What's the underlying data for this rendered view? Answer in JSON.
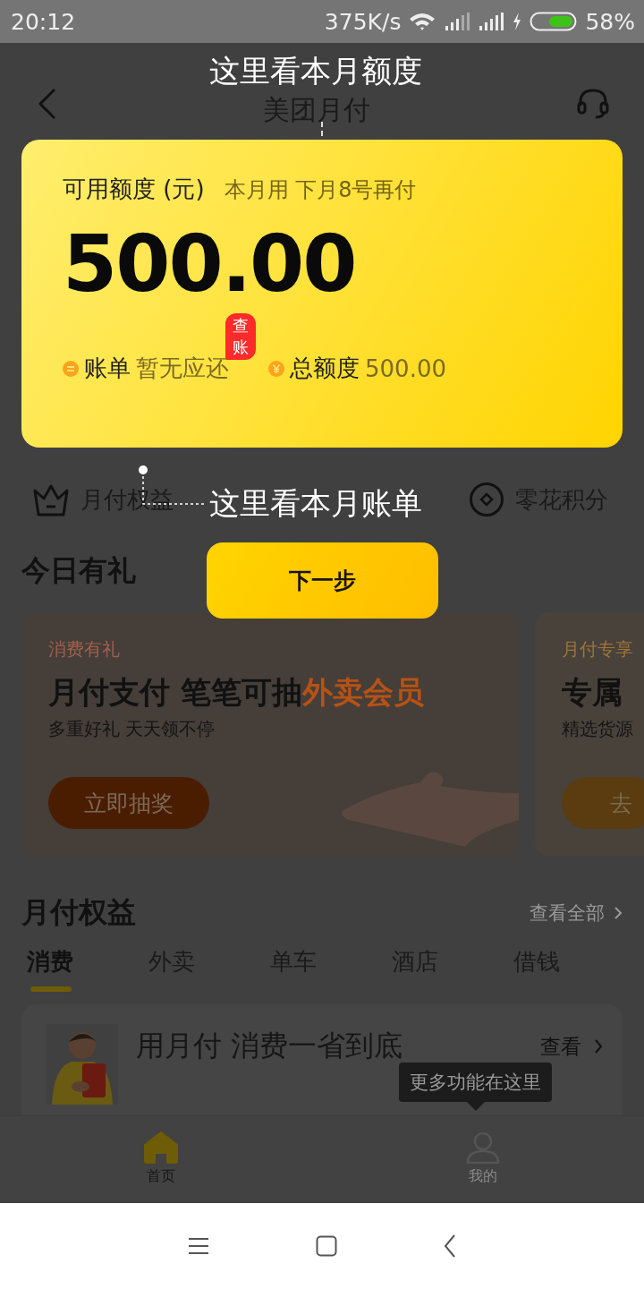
{
  "status_bar": {
    "time": "20:12",
    "speed": "375K/s",
    "battery": "58%"
  },
  "header": {
    "title": "美团月付"
  },
  "credit_card": {
    "label": "可用额度 (元)",
    "note": "本月用 下月8号再付",
    "amount": "500.00",
    "bill_badge": "查账",
    "bill_label": "账单",
    "bill_status": "暂无应还",
    "total_label": "总额度",
    "total_value": "500.00"
  },
  "shortcuts": [
    {
      "kind": "crown",
      "label": "月付权益"
    },
    {
      "kind": "coin",
      "label": "零花积分"
    }
  ],
  "guide": {
    "steps": [
      "这里看本月额度",
      "这里看本月账单"
    ],
    "next_button": "下一步",
    "tooltip": "更多功能在这里"
  },
  "today_gifts": {
    "title": "今日有礼",
    "cards": [
      {
        "tag": "消费有礼",
        "title": "月付支付 笔笔可抽",
        "title_highlight": "外卖会员",
        "subtitle": "多重好礼 天天领不停",
        "button": "立即抽奖"
      },
      {
        "tag": "月付专享",
        "title": "专属",
        "subtitle": "精选货源",
        "button": "去"
      }
    ]
  },
  "benefits": {
    "title": "月付权益",
    "more": "查看全部",
    "tabs": [
      {
        "label": "消费",
        "selected": true
      },
      {
        "label": "外卖",
        "selected": false
      },
      {
        "label": "单车",
        "selected": false
      },
      {
        "label": "酒店",
        "selected": false
      },
      {
        "label": "借钱",
        "selected": false
      }
    ],
    "promo": {
      "text": "用月付 消费一省到底",
      "action": "查看"
    }
  },
  "bottom_nav": [
    {
      "label": "首页",
      "selected": true
    },
    {
      "label": "我的",
      "selected": false
    }
  ]
}
